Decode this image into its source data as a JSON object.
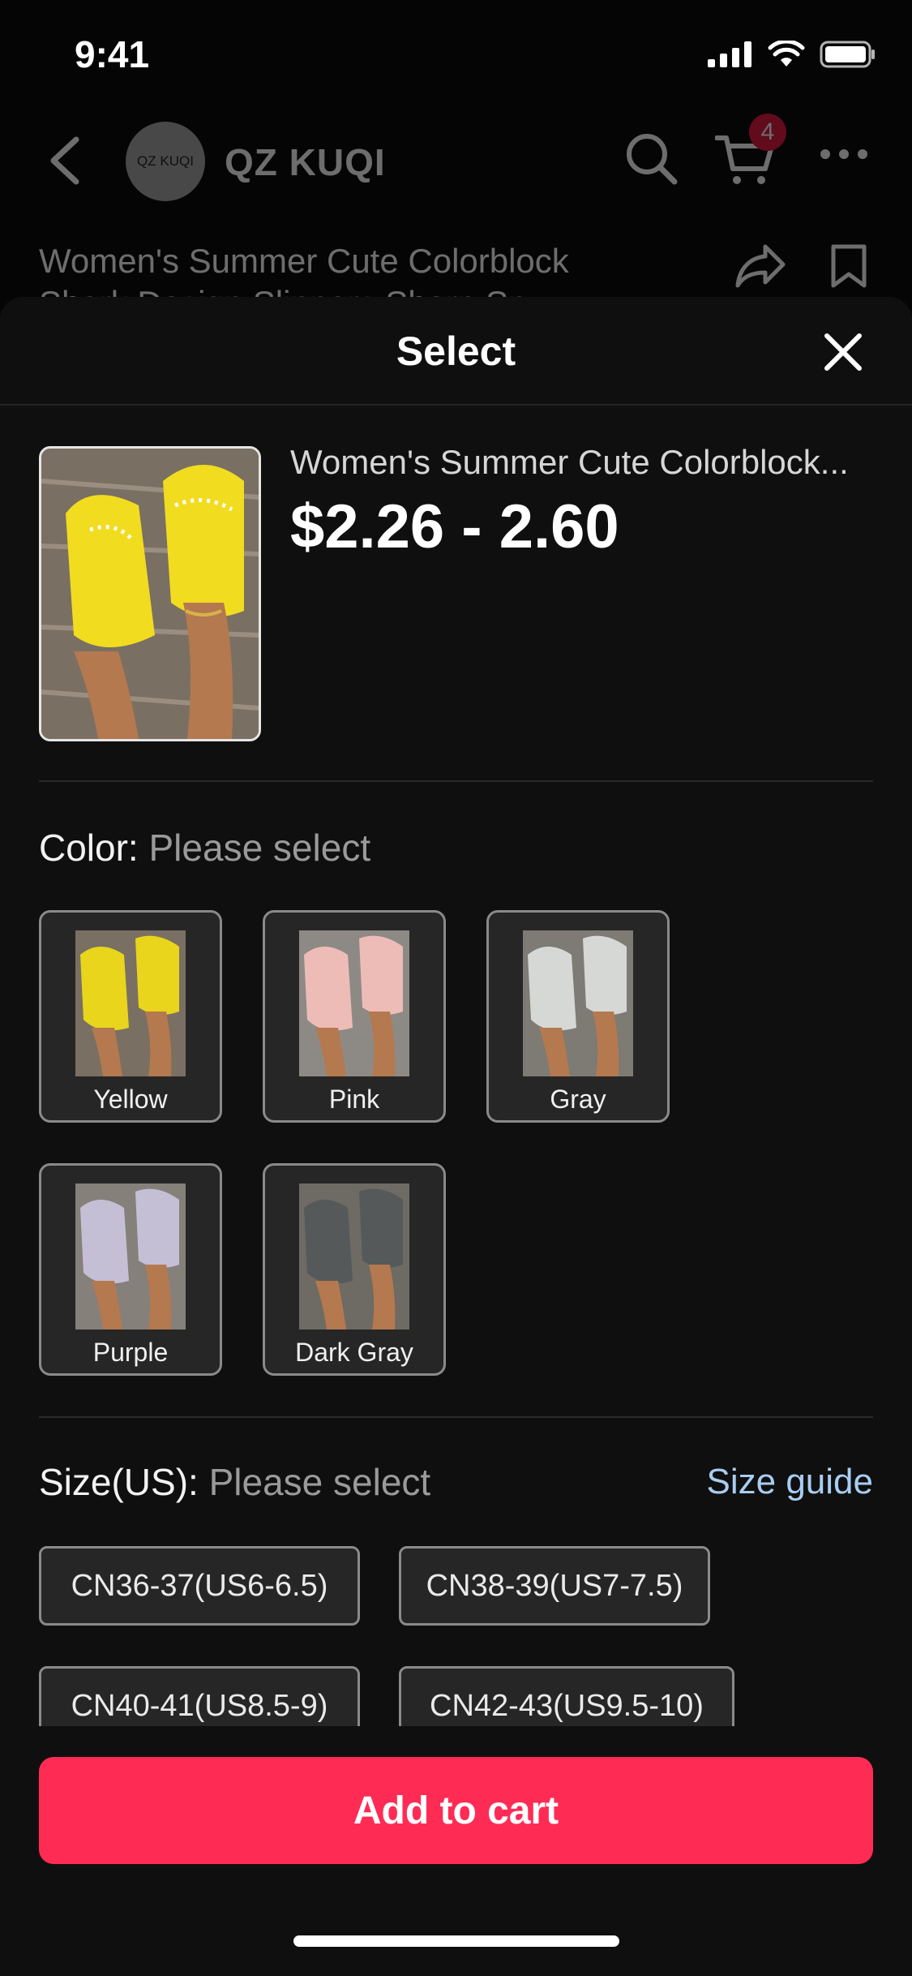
{
  "status_bar": {
    "time": "9:41"
  },
  "header": {
    "shop_avatar_text": "QZ KUQI",
    "shop_name": "QZ KUQI",
    "cart_count": "4"
  },
  "background_product_title": "Women's Summer Cute Colorblock Shark Design Slippers Sharp Sp",
  "sheet": {
    "title": "Select",
    "product": {
      "name": "Women's Summer Cute Colorblock...",
      "price": "$2.26 - 2.60"
    },
    "color": {
      "label": "Color:",
      "hint": "Please select",
      "options": [
        {
          "name": "Yellow",
          "swatch": "#e8d51c"
        },
        {
          "name": "Pink",
          "swatch": "#eebcb7"
        },
        {
          "name": "Gray",
          "swatch": "#d6d8d6"
        },
        {
          "name": "Purple",
          "swatch": "#c5bfd6"
        },
        {
          "name": "Dark Gray",
          "swatch": "#55595a"
        }
      ]
    },
    "size": {
      "label": "Size(US):",
      "hint": "Please select",
      "guide": "Size guide",
      "options": [
        "CN36-37(US6-6.5)",
        "CN38-39(US7-7.5)",
        "CN40-41(US8.5-9)",
        "CN42-43(US9.5-10)"
      ]
    },
    "add_to_cart": "Add to cart"
  },
  "colors": {
    "accent": "#fe2c55",
    "link": "#a9cdf2",
    "badge": "#e2163e"
  }
}
